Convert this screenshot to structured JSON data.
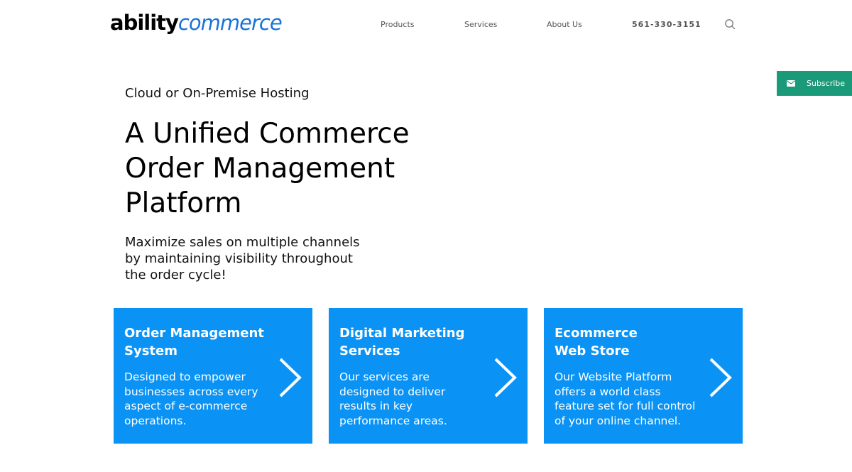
{
  "header": {
    "logo": {
      "part1": "ability",
      "part2": "commerce",
      "brand_color": "#1a73d9"
    },
    "nav": {
      "products": "Products",
      "services": "Services",
      "about": "About Us",
      "phone": "561-330-3151"
    },
    "search_icon": "search-icon"
  },
  "subscribe": {
    "label": "Subscribe",
    "icon": "envelope-icon",
    "color": "#1a9a78"
  },
  "hero": {
    "eyebrow": "Cloud or On-Premise Hosting",
    "headline_lines": [
      "A Unified Commerce",
      "Order Management",
      "Platform"
    ],
    "tagline_lines": [
      "Maximize sales on multiple channels",
      "by maintaining visibility throughout",
      "the order cycle!"
    ]
  },
  "cards": [
    {
      "title_lines": [
        "Order Management",
        "System"
      ],
      "desc_lines": [
        "Designed to empower",
        "businesses across every",
        "aspect of e-commerce",
        "operations."
      ],
      "icon": "chevron-right-icon"
    },
    {
      "title_lines": [
        "Digital Marketing",
        "Services"
      ],
      "desc_lines": [
        "Our services are",
        "designed to deliver",
        "results in key",
        "performance areas."
      ],
      "icon": "chevron-right-icon"
    },
    {
      "title_lines": [
        "Ecommerce",
        "Web Store"
      ],
      "desc_lines": [
        "Our Website Platform",
        "offers a world class",
        "feature set for full control",
        "of your online channel."
      ],
      "icon": "chevron-right-icon"
    }
  ],
  "colors": {
    "card_background": "#0a93f5",
    "text": "#111111"
  }
}
